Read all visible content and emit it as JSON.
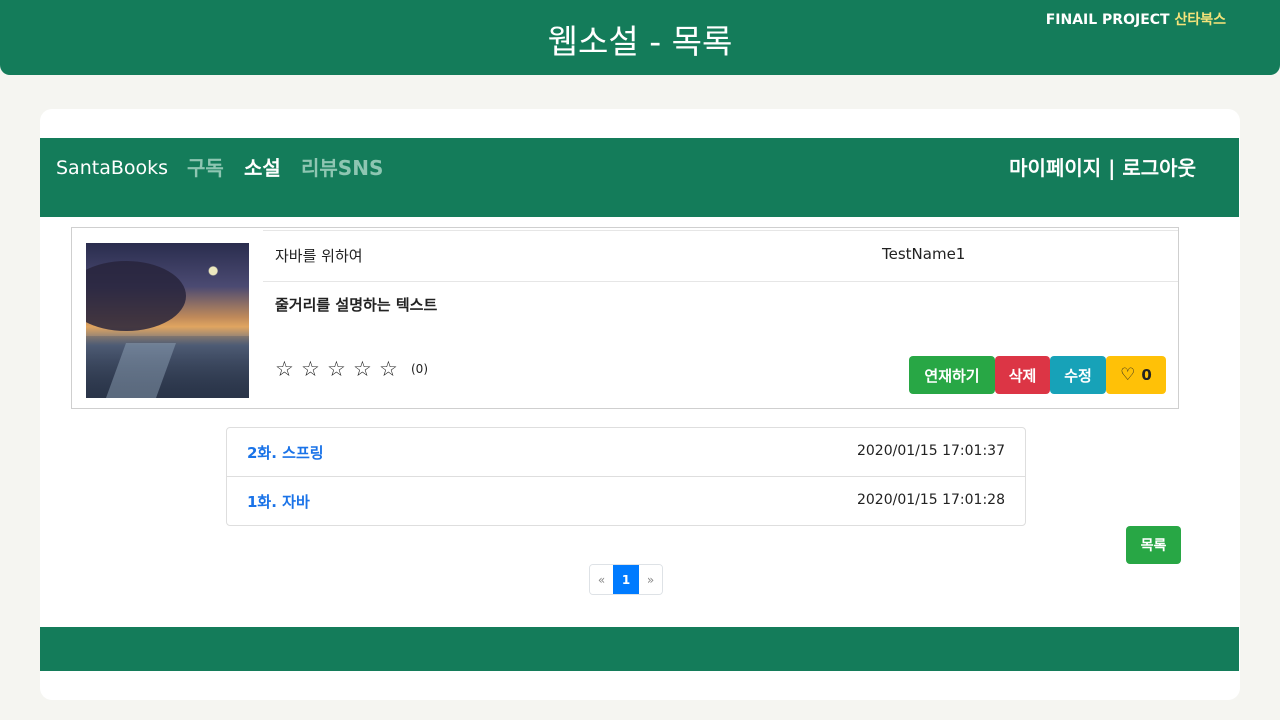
{
  "header": {
    "title": "웹소설 - 목록",
    "tag_prefix": "FINAIL PROJECT",
    "tag_accent": "산타북스"
  },
  "nav": {
    "brand": "SantaBooks",
    "items": [
      {
        "label": "구독",
        "active": false
      },
      {
        "label": "소설",
        "active": true
      },
      {
        "label": "리뷰SNS",
        "active": false
      }
    ],
    "right": "마이페이지 | 로그아웃"
  },
  "novel": {
    "title": "자바를 위하여",
    "author": "TestName1",
    "description": "줄거리를 설명하는 텍스트",
    "stars": [
      "☆",
      "☆",
      "☆",
      "☆",
      "☆"
    ],
    "rating_count": "(0)",
    "buttons": {
      "serial": "연재하기",
      "delete": "삭제",
      "edit": "수정",
      "like_count": "0"
    }
  },
  "episodes": [
    {
      "title": "2화. 스프링",
      "date": "2020/01/15 17:01:37"
    },
    {
      "title": "1화. 자바",
      "date": "2020/01/15 17:01:28"
    }
  ],
  "list_button": "목록",
  "pagination": {
    "prev": "«",
    "current": "1",
    "next": "»"
  },
  "colors": {
    "primary_green": "#147c5a",
    "success": "#28a745",
    "danger": "#dc3545",
    "info": "#17a2b8",
    "warning": "#ffc107",
    "link": "#1a73e8",
    "accent_yellow": "#f5e37a"
  },
  "icons": {
    "heart": "heart-icon",
    "star": "star-icon"
  }
}
